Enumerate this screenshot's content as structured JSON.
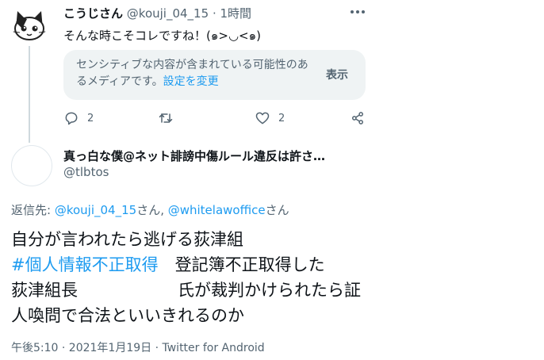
{
  "reply_tweet": {
    "display_name": "こうじさん",
    "handle": "@kouji_04_15",
    "separator": "·",
    "time": "1時間",
    "text": "そんな時こそコレですね！(๑>◡<๑)",
    "sensitive": {
      "text": "センシティブな内容が含まれている可能性のあるメディアです。",
      "link": "設定を変更",
      "button": "表示"
    },
    "replies": "2",
    "likes": "2"
  },
  "main_tweet": {
    "display_name": "真っ白な僕@ネット誹謗中傷ルール違反は許さ…",
    "handle": "@tlbtos",
    "reply_prefix": "返信先: ",
    "mention1": "@kouji_04_15",
    "san1": "さん, ",
    "mention2": "@whitelawoffice",
    "san2": "さん",
    "line1": "自分が言われたら逃げる荻津組",
    "hashtag": "#個人情報不正取得",
    "line2_rest": "　登記簿不正取得した",
    "line3": "荻津組長　　　　　　氏が裁判かけられたら証",
    "line4": "人喚問で合法といいきれるのか",
    "meta": "午後5:10 · 2021年1月19日 · Twitter for Android"
  },
  "icons": [
    "cat-avatar-icon",
    "more-icon",
    "reply-icon",
    "retweet-icon",
    "like-icon",
    "share-icon"
  ],
  "colors": {
    "accent": "#1d9bf0",
    "muted": "#536471",
    "text": "#0f1419",
    "card": "#eff3f4"
  }
}
